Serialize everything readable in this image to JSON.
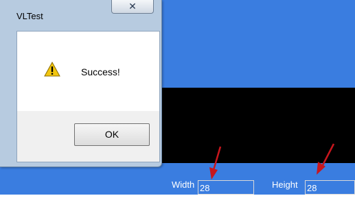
{
  "dialog": {
    "title": "VLTest",
    "message": "Success!",
    "ok_label": "OK",
    "close_glyph": "✕"
  },
  "form": {
    "width_label": "Width",
    "width_value": "28",
    "height_label": "Height",
    "height_value": "28"
  },
  "icons": {
    "dialog_icon": "warning-icon",
    "annotation": "red-arrow-icon"
  },
  "colors": {
    "app_blue": "#3a7de0",
    "canvas_black": "#000000",
    "arrow_red": "#c8161d",
    "warning_yellow": "#f2c60f"
  }
}
